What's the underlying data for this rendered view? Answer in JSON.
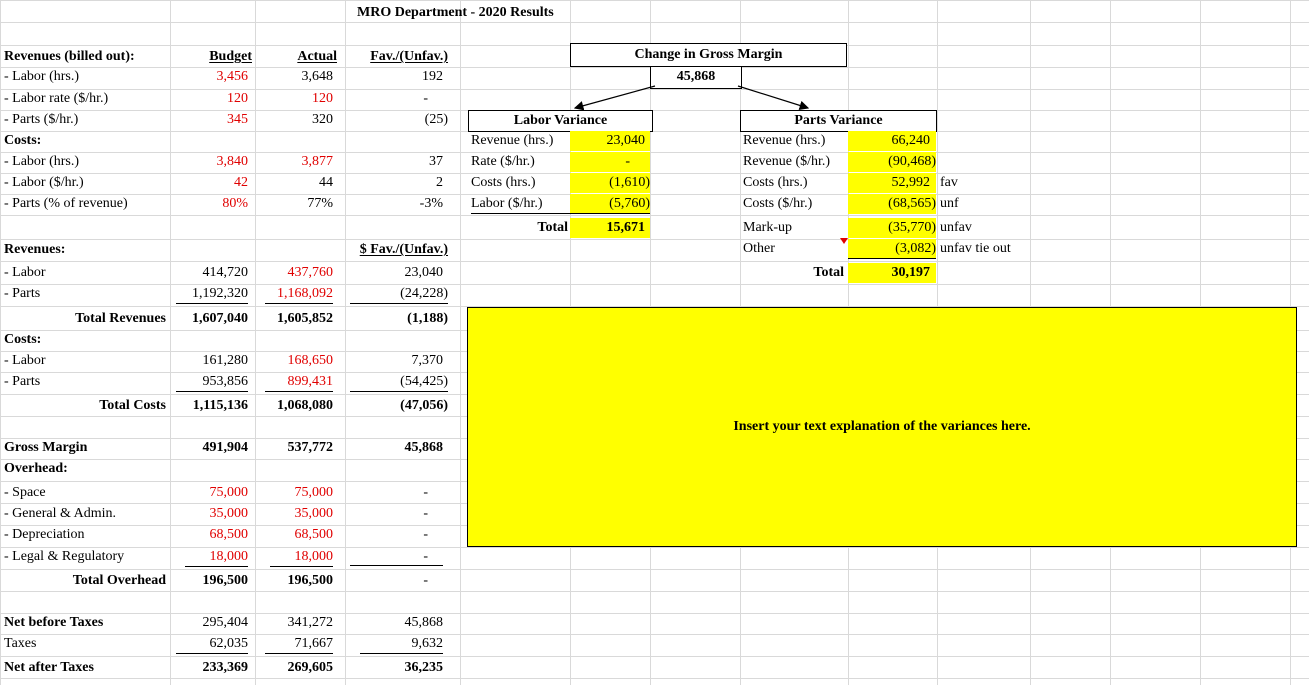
{
  "title": "MRO Department - 2020 Results",
  "headers": {
    "budget": "Budget",
    "actual": "Actual",
    "fav": "Fav./(Unfav.)",
    "fav_dollar": "$ Fav./(Unfav.)"
  },
  "drivers": {
    "revenues_label": "Revenues (billed out):",
    "rev_rows": [
      {
        "label": "- Labor (hrs.)",
        "budget": "3,456",
        "actual": "3,648",
        "fav": "192"
      },
      {
        "label": "- Labor rate ($/hr.)",
        "budget": "120",
        "actual": "120",
        "fav": "-"
      },
      {
        "label": "- Parts ($/hr.)",
        "budget": "345",
        "actual": "320",
        "fav": "(25)"
      }
    ],
    "costs_label": "Costs:",
    "cost_rows": [
      {
        "label": "- Labor (hrs.)",
        "budget": "3,840",
        "actual": "3,877",
        "fav": "37"
      },
      {
        "label": "- Labor ($/hr.)",
        "budget": "42",
        "actual": "44",
        "fav": "2"
      },
      {
        "label": "- Parts (% of revenue)",
        "budget": "80%",
        "actual": "77%",
        "fav": "-3%"
      }
    ]
  },
  "pl": {
    "revenues_label": "Revenues:",
    "rev_rows": [
      {
        "label": "- Labor",
        "budget": "414,720",
        "actual": "437,760",
        "fav": "23,040"
      },
      {
        "label": "- Parts",
        "budget": "1,192,320",
        "actual": "1,168,092",
        "fav": "(24,228)"
      }
    ],
    "total_revenues": {
      "label": "Total Revenues",
      "budget": "1,607,040",
      "actual": "1,605,852",
      "fav": "(1,188)"
    },
    "costs_label": "Costs:",
    "cost_rows": [
      {
        "label": "- Labor",
        "budget": "161,280",
        "actual": "168,650",
        "fav": "7,370"
      },
      {
        "label": "- Parts",
        "budget": "953,856",
        "actual": "899,431",
        "fav": "(54,425)"
      }
    ],
    "total_costs": {
      "label": "Total Costs",
      "budget": "1,115,136",
      "actual": "1,068,080",
      "fav": "(47,056)"
    },
    "gross_margin": {
      "label": "Gross Margin",
      "budget": "491,904",
      "actual": "537,772",
      "fav": "45,868"
    },
    "overhead_label": "Overhead:",
    "overhead_rows": [
      {
        "label": "- Space",
        "budget": "75,000",
        "actual": "75,000",
        "fav": "-"
      },
      {
        "label": "- General & Admin.",
        "budget": "35,000",
        "actual": "35,000",
        "fav": "-"
      },
      {
        "label": "- Depreciation",
        "budget": "68,500",
        "actual": "68,500",
        "fav": "-"
      },
      {
        "label": "- Legal & Regulatory",
        "budget": "18,000",
        "actual": "18,000",
        "fav": "-"
      }
    ],
    "total_overhead": {
      "label": "Total Overhead",
      "budget": "196,500",
      "actual": "196,500",
      "fav": "-"
    },
    "net_before": {
      "label": "Net before Taxes",
      "budget": "295,404",
      "actual": "341,272",
      "fav": "45,868"
    },
    "taxes": {
      "label": "Taxes",
      "budget": "62,035",
      "actual": "71,667",
      "fav": "9,632"
    },
    "net_after": {
      "label": "Net after Taxes",
      "budget": "233,369",
      "actual": "269,605",
      "fav": "36,235"
    }
  },
  "gross_margin_change": {
    "title": "Change in Gross Margin",
    "value": "45,868"
  },
  "labor_variance": {
    "title": "Labor Variance",
    "rows": [
      {
        "label": "Revenue (hrs.)",
        "value": "23,040"
      },
      {
        "label": "Rate ($/hr.)",
        "value": "-"
      },
      {
        "label": "Costs (hrs.)",
        "value": "(1,610)"
      },
      {
        "label": "Labor ($/hr.)",
        "value": "(5,760)"
      }
    ],
    "total_label": "Total",
    "total_value": "15,671"
  },
  "parts_variance": {
    "title": "Parts Variance",
    "rows": [
      {
        "label": "Revenue (hrs.)",
        "value": "66,240",
        "note": ""
      },
      {
        "label": "Revenue ($/hr.)",
        "value": "(90,468)",
        "note": ""
      },
      {
        "label": "Costs (hrs.)",
        "value": "52,992",
        "note": "fav"
      },
      {
        "label": "Costs ($/hr.)",
        "value": "(68,565)",
        "note": "unf"
      },
      {
        "label": "Mark-up",
        "value": "(35,770)",
        "note": "unfav"
      },
      {
        "label": "Other",
        "value": "(3,082)",
        "note": "unfav tie out"
      }
    ],
    "total_label": "Total",
    "total_value": "30,197"
  },
  "explanation": {
    "text": "Insert your text explanation of the variances here."
  },
  "colors": {
    "highlight": "#ffff00",
    "budget_text": "#e00000",
    "grid": "#d9d9d9"
  }
}
